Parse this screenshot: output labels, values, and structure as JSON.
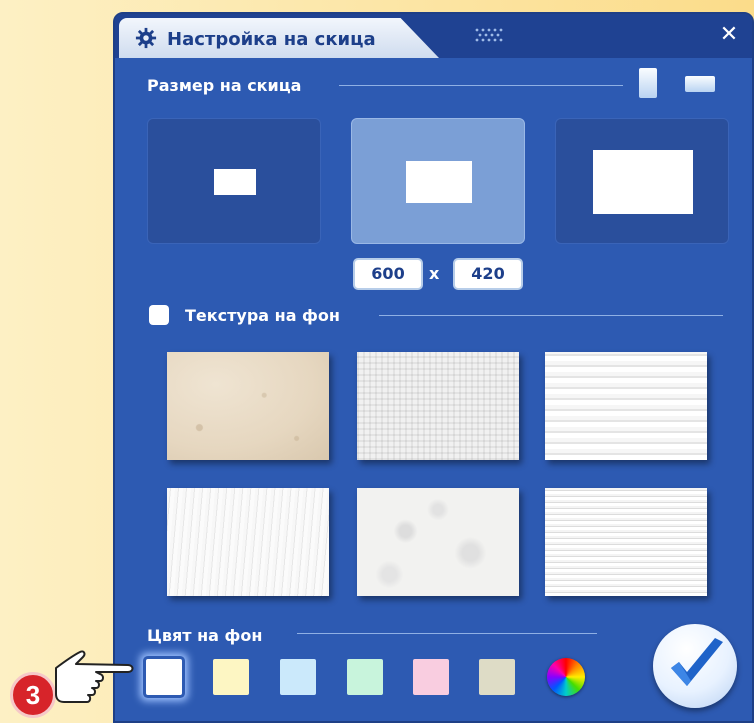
{
  "dialog": {
    "title": "Настройка на скица",
    "close_symbol": "✕"
  },
  "sketch_size": {
    "label": "Размер на скица",
    "orientations": [
      "portrait",
      "landscape"
    ],
    "presets": [
      "small",
      "medium",
      "large"
    ],
    "selected_preset": "medium",
    "width": "600",
    "separator": "x",
    "height": "420"
  },
  "background_texture": {
    "label": "Текстура на фон",
    "checked": false,
    "textures": [
      "paper-stained",
      "canvas-weave",
      "horizontal-stripes",
      "fibrous-paper",
      "crumpled-paper",
      "fine-lines"
    ]
  },
  "background_color": {
    "label": "Цвят на фон",
    "swatches": [
      "#ffffff",
      "#fdf6c3",
      "#cbe9fb",
      "#c8f4dc",
      "#f9cde0",
      "#dedcc6"
    ],
    "selected": "#ffffff",
    "custom_color_icon": "color-wheel-icon"
  },
  "confirm_icon": "checkmark-icon",
  "annotation": {
    "step_number": "3",
    "icon": "pointer-hand-icon"
  }
}
